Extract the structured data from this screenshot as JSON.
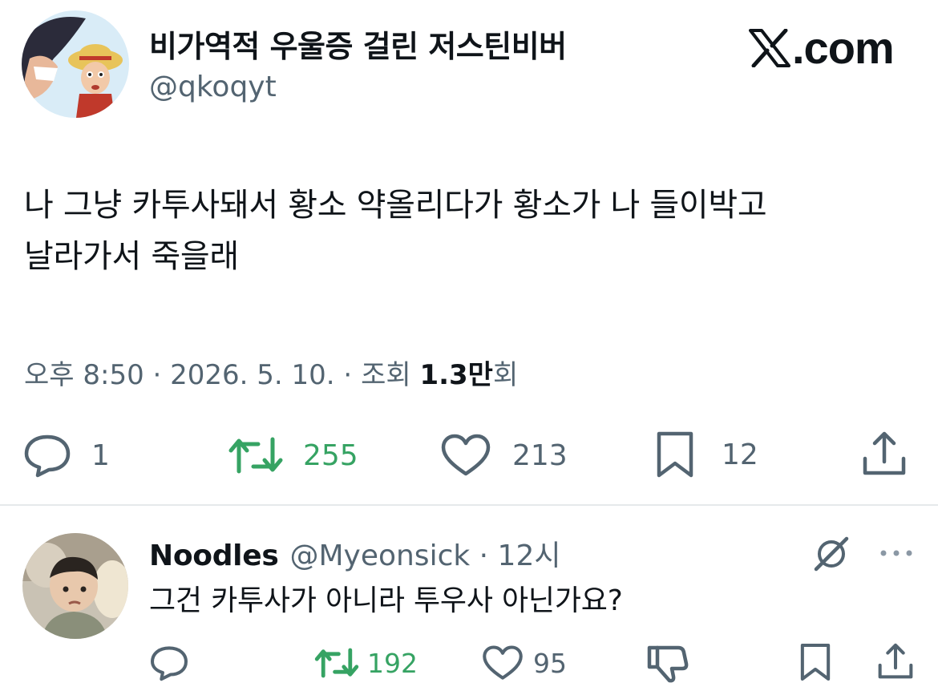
{
  "tweet": {
    "author_name": "비가역적 우울증 걸린 저스틴비버",
    "author_handle": "@qkoqyt",
    "site_label": ".com",
    "body_line1": "나 그냥 카투사돼서 황소 약올리다가 황소가 나 들이박고",
    "body_line2": "날라가서 죽을래",
    "time": "오후 8:50",
    "sep1": " · ",
    "date": "2026. 5. 10.",
    "sep2": " · ",
    "views_label": "조회 ",
    "views_number": "1.3만",
    "views_suffix": "회",
    "actions": {
      "reply_count": "1",
      "retweet_count": "255",
      "like_count": "213",
      "bookmark_count": "12"
    }
  },
  "reply": {
    "name": "Noodles",
    "handle_time": "@Myeonsick · 12시",
    "text": "그건 카투사가 아니라 투우사 아닌가요?",
    "actions": {
      "retweet_count": "192",
      "like_count": "95"
    }
  },
  "icons": {
    "reply": "speech-bubble-icon",
    "retweet": "retweet-icon",
    "like": "heart-icon",
    "bookmark": "bookmark-icon",
    "share": "share-icon",
    "grok": "grok-icon",
    "more": "more-icon",
    "dislike": "thumbs-down-icon"
  },
  "colors": {
    "text": "#0f1419",
    "secondary": "#536471",
    "retweet_green": "#36a363",
    "divider": "#e6e9eb"
  }
}
